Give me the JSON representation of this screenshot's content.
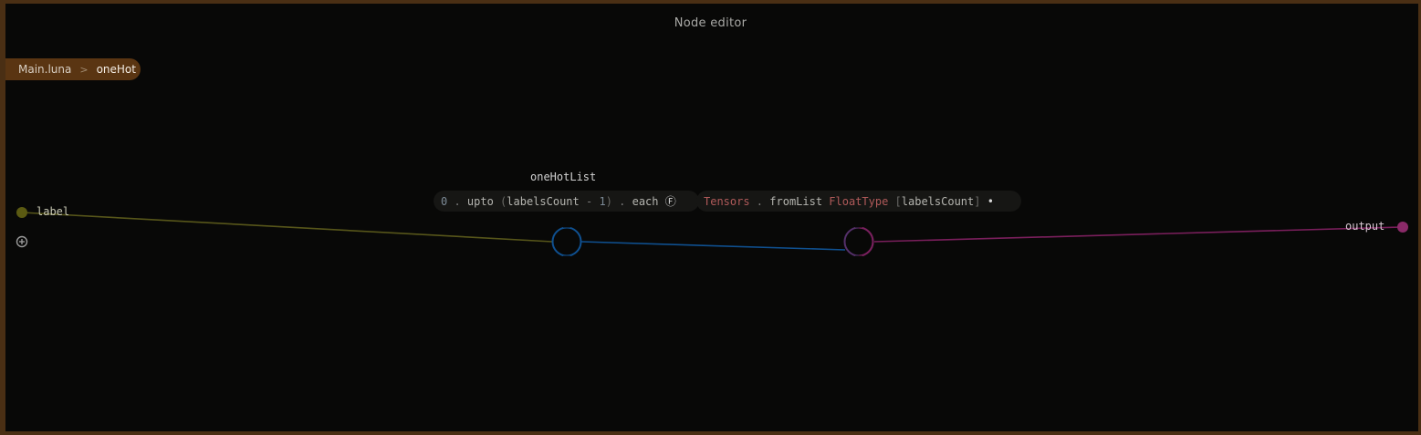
{
  "title": "Node editor",
  "breadcrumb": {
    "root": "Main.luna",
    "separator": ">",
    "current": "oneHot"
  },
  "inputs": [
    {
      "label": "label"
    }
  ],
  "add_port_icon": "plus-circle-icon",
  "outputs": [
    {
      "label": "output"
    }
  ],
  "nodes": [
    {
      "name": "oneHotList",
      "expression": {
        "t0": "0",
        "t1": " . ",
        "t2": "upto",
        "t3": " (",
        "t4": "labelsCount",
        "t5": " - ",
        "t6": "1",
        "t7": ")",
        "t8": " . ",
        "t9": "each",
        "t10": " Ⓕ"
      }
    },
    {
      "name": "",
      "expression": {
        "t0": "Tensors",
        "t1": " . ",
        "t2": "fromList",
        "t3": " ",
        "t4": "FloatType",
        "t5": " [",
        "t6": "labelsCount",
        "t7": "]",
        "t8": " •"
      }
    }
  ],
  "colors": {
    "frame": "#4a2f14",
    "breadcrumb_bg": "#5a3512",
    "input_port": "#5b5a12",
    "input_edge": "#57561a",
    "mid_edge": "#0f5090",
    "output_edge": "#7a1f5c",
    "output_port": "#8a2a68",
    "node_purple": "#55306a"
  }
}
